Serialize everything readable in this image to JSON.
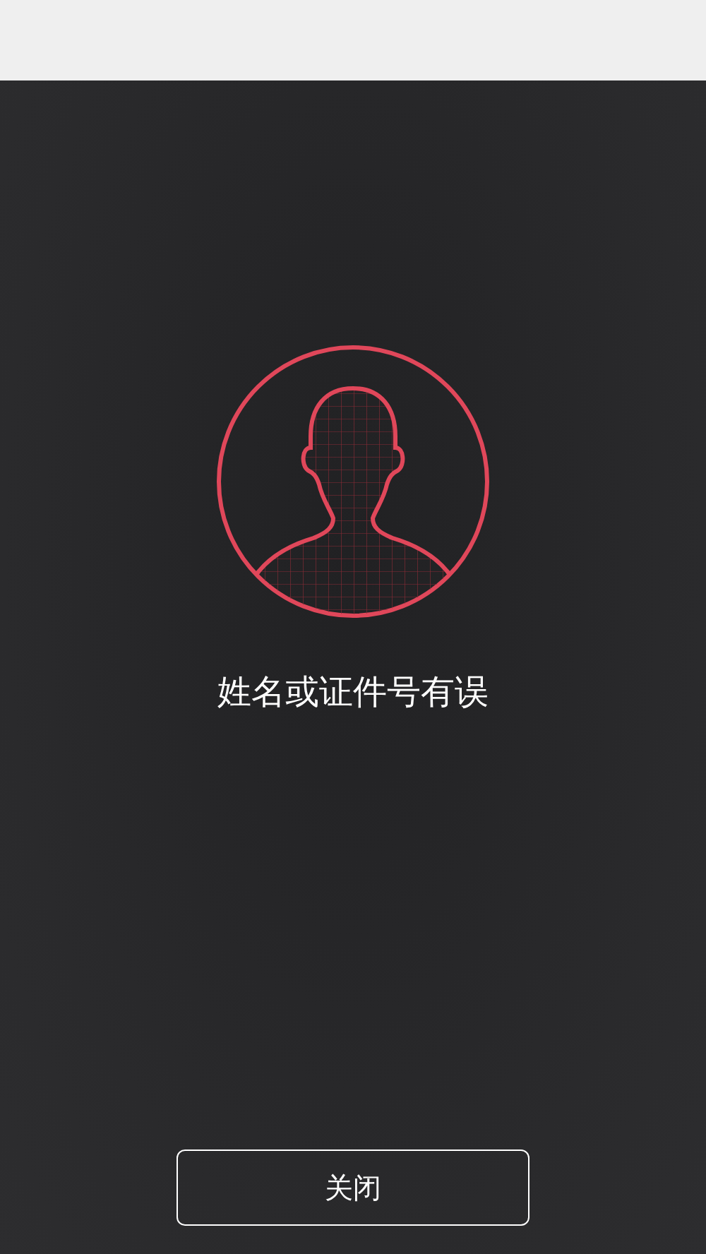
{
  "message": "姓名或证件号有误",
  "close_button": {
    "label": "关闭"
  }
}
